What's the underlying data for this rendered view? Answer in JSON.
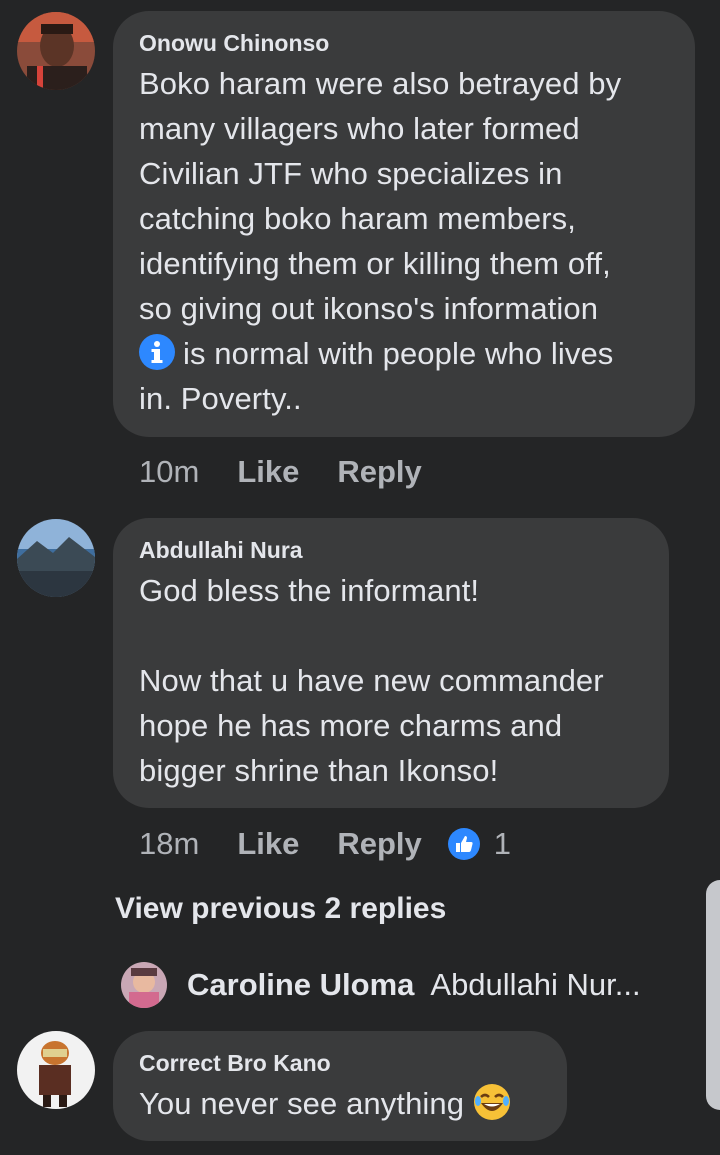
{
  "comments": [
    {
      "author": "Onowu Chinonso",
      "text_lines_before_icon": "Boko haram were also betrayed by\nmany villagers who later formed\nCivilian JTF who specializes in\ncatching boko haram members,\nidentifying them or killing them off,\nso giving out ikonso's information",
      "text_after_icon": "is normal with people who lives\nin. Poverty..",
      "inline_icon": "information-icon",
      "time": "10m",
      "like_label": "Like",
      "reply_label": "Reply"
    },
    {
      "author": "Abdullahi Nura",
      "text": "God bless the informant!\n\nNow that u have new commander\nhope he has more charms and\nbigger shrine than Ikonso!",
      "time": "18m",
      "like_label": "Like",
      "reply_label": "Reply",
      "reaction_icon": "thumbs-up-icon",
      "reaction_count": "1"
    },
    {
      "author": "Correct Bro Kano",
      "text": "You never see anything",
      "emoji": "laughing-emoji-icon"
    }
  ],
  "view_previous": "View previous 2 replies",
  "reply_preview": {
    "name": "Caroline Uloma",
    "text": "Abdullahi Nur..."
  },
  "colors": {
    "background": "#242526",
    "bubble": "#3a3b3c",
    "text": "#e4e6eb",
    "secondary": "#b0b3b8",
    "like_blue": "#2d88ff"
  }
}
